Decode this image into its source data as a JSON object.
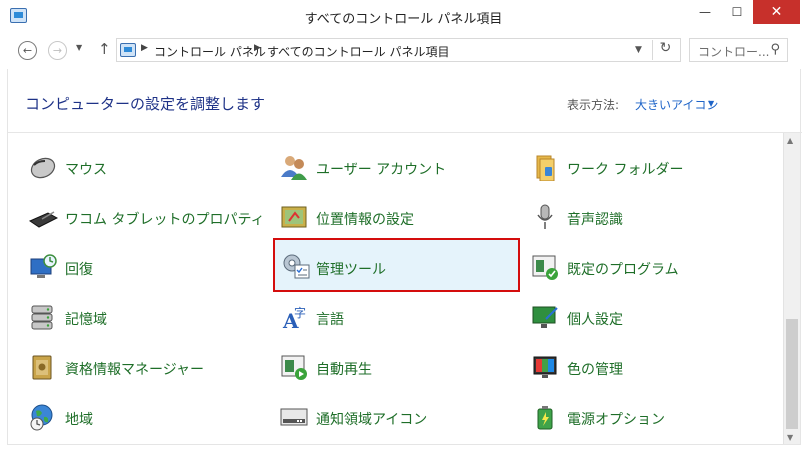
{
  "window": {
    "title": "すべてのコントロール パネル項目",
    "minimize_glyph": "—",
    "maximize_glyph": "☐",
    "close_glyph": "✕"
  },
  "nav": {
    "back_glyph": "←",
    "forward_glyph": "→",
    "recent_glyph": "▼",
    "up_glyph": "↑",
    "breadcrumbs": [
      "コントロール パネル",
      "すべてのコントロール パネル項目"
    ],
    "separator_glyph": "▶",
    "dropdown_glyph": "▼",
    "refresh_glyph": "↻",
    "search_placeholder": "コントロー...",
    "search_glyph": "⚲"
  },
  "header": {
    "heading": "コンピューターの設定を調整します",
    "view_label": "表示方法:",
    "view_value": "大きいアイコン",
    "view_arrow": "▼"
  },
  "items": [
    {
      "label": "マウス",
      "icon": "mouse-icon",
      "col": 0,
      "row": 0
    },
    {
      "label": "ユーザー アカウント",
      "icon": "user-accounts-icon",
      "col": 1,
      "row": 0
    },
    {
      "label": "ワーク フォルダー",
      "icon": "work-folders-icon",
      "col": 2,
      "row": 0
    },
    {
      "label": "ワコム タブレットのプロパティ",
      "icon": "wacom-tablet-icon",
      "col": 0,
      "row": 1
    },
    {
      "label": "位置情報の設定",
      "icon": "location-settings-icon",
      "col": 1,
      "row": 1
    },
    {
      "label": "音声認識",
      "icon": "microphone-icon",
      "col": 2,
      "row": 1
    },
    {
      "label": "回復",
      "icon": "recovery-icon",
      "col": 0,
      "row": 2
    },
    {
      "label": "管理ツール",
      "icon": "admin-tools-icon",
      "col": 1,
      "row": 2,
      "selected": true
    },
    {
      "label": "既定のプログラム",
      "icon": "default-programs-icon",
      "col": 2,
      "row": 2
    },
    {
      "label": "記憶域",
      "icon": "storage-spaces-icon",
      "col": 0,
      "row": 3
    },
    {
      "label": "言語",
      "icon": "language-icon",
      "col": 1,
      "row": 3
    },
    {
      "label": "個人設定",
      "icon": "personalization-icon",
      "col": 2,
      "row": 3
    },
    {
      "label": "資格情報マネージャー",
      "icon": "credential-manager-icon",
      "col": 0,
      "row": 4
    },
    {
      "label": "自動再生",
      "icon": "autoplay-icon",
      "col": 1,
      "row": 4
    },
    {
      "label": "色の管理",
      "icon": "color-management-icon",
      "col": 2,
      "row": 4
    },
    {
      "label": "地域",
      "icon": "region-icon",
      "col": 0,
      "row": 5
    },
    {
      "label": "通知領域アイコン",
      "icon": "notification-area-icon",
      "col": 1,
      "row": 5
    },
    {
      "label": "電源オプション",
      "icon": "power-options-icon",
      "col": 2,
      "row": 5
    }
  ],
  "colors": {
    "item_text": "#1e6e28",
    "heading": "#1e3287",
    "link": "#1e64c8",
    "selection_border": "#d40d0d",
    "selection_fill": "#e5f3fb",
    "close_button": "#c7302b"
  }
}
